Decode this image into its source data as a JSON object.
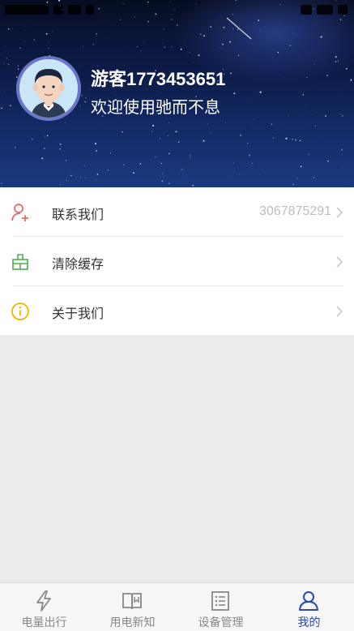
{
  "profile": {
    "name": "游客1773453651",
    "welcome": "欢迎使用驰而不息"
  },
  "menu": {
    "items": [
      {
        "label": "联系我们",
        "value": "3067875291",
        "icon": "add-user-icon"
      },
      {
        "label": "清除缓存",
        "value": "",
        "icon": "broom-icon"
      },
      {
        "label": "关于我们",
        "value": "",
        "icon": "info-icon"
      }
    ]
  },
  "tabs": [
    {
      "label": "电量出行",
      "icon": "lightning-icon",
      "active": false
    },
    {
      "label": "用电新知",
      "icon": "book-icon",
      "active": false
    },
    {
      "label": "设备管理",
      "icon": "list-icon",
      "active": false
    },
    {
      "label": "我的",
      "icon": "person-icon",
      "active": true
    }
  ],
  "colors": {
    "accent": "#2a47b6",
    "contact_icon": "#f06a6a",
    "cache_icon": "#4caf50",
    "about_icon": "#f5b400",
    "tab_inactive": "#888888"
  }
}
